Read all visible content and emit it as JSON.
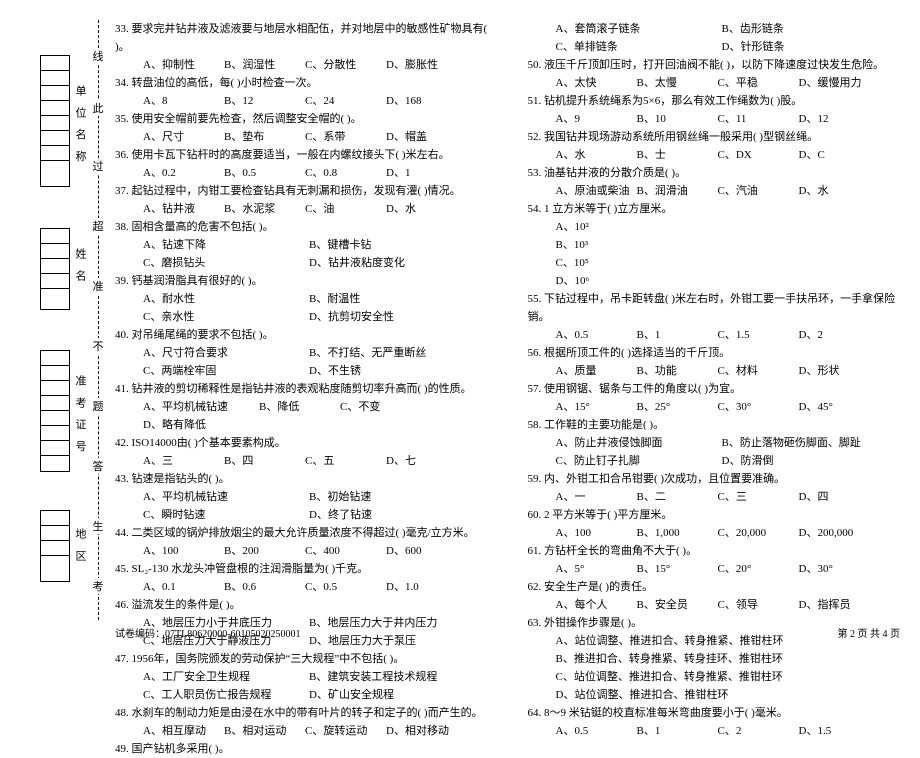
{
  "margin": {
    "labels": {
      "unit": "单 位 名 称",
      "name": "姓    名",
      "exam": "准 考 证 号",
      "area": "地  区"
    },
    "markers": [
      "线",
      "此",
      "过",
      "超",
      "准",
      "不",
      "题",
      "答",
      "生",
      "考"
    ]
  },
  "left": {
    "q33": {
      "stem": "33. 要求完井钻井液及滤液要与地层水相配伍，并对地层中的敏感性矿物具有(    )。",
      "a": "A、抑制性",
      "b": "B、润湿性",
      "c": "C、分散性",
      "d": "D、膨胀性"
    },
    "q34": {
      "stem": "34. 转盘油位的高低，每(    )小时检查一次。",
      "a": "A、8",
      "b": "B、12",
      "c": "C、24",
      "d": "D、168"
    },
    "q35": {
      "stem": "35. 使用安全帽前要先检查，然后调整安全帽的(    )。",
      "a": "A、尺寸",
      "b": "B、垫布",
      "c": "C、系带",
      "d": "D、帽盖"
    },
    "q36": {
      "stem": "36. 使用卡瓦下钻杆时的高度要适当，一般在内螺纹接头下(    )米左右。",
      "a": "A、0.2",
      "b": "B、0.5",
      "c": "C、0.8",
      "d": "D、1"
    },
    "q37": {
      "stem": "37. 起钻过程中，内钳工要检查钻具有无刺漏和损伤，发现有灌(    )情况。",
      "a": "A、钻井液",
      "b": "B、水泥浆",
      "c": "C、油",
      "d": "D、水"
    },
    "q38": {
      "stem": "38. 固相含量高的危害不包括(    )。",
      "a": "A、钻速下降",
      "b": "B、键槽卡钻",
      "c": "C、磨损钻头",
      "d": "D、钻井液粘度变化"
    },
    "q39": {
      "stem": "39. 钙基润滑脂具有很好的(    )。",
      "a": "A、耐水性",
      "b": "B、耐温性",
      "c": "C、亲水性",
      "d": "D、抗剪切安全性"
    },
    "q40": {
      "stem": "40. 对吊绳尾绳的要求不包括(    )。",
      "a": "A、尺寸符合要求",
      "b": "B、不打结、无严重断丝",
      "c": "C、两端栓牢固",
      "d": "D、不生锈"
    },
    "q41": {
      "stem": "41. 钻井液的剪切稀释性是指钻井液的表观粘度随剪切率升高而(    )的性质。",
      "a": "A、平均机械钻速",
      "b": "B、降低",
      "c": "C、不变",
      "d": "D、略有降低"
    },
    "q42": {
      "stem": "42. ISO14000由(    )个基本要素构成。",
      "a": "A、三",
      "b": "B、四",
      "c": "C、五",
      "d": "D、七"
    },
    "q43": {
      "stem": "43. 钻速是指钻头的(    )。",
      "a": "A、平均机械钻速",
      "b": "B、初始钻速",
      "c": "C、瞬时钻速",
      "d": "D、终了钻速"
    },
    "q44": {
      "stem": "44. 二类区域的锅炉排放烟尘的最大允许质量浓度不得超过(    )毫克/立方米。",
      "a": "A、100",
      "b": "B、200",
      "c": "C、400",
      "d": "D、600"
    },
    "q45": {
      "stem": "45. SL₂-130 水龙头冲管盘根的注润滑脂量为(    )千克。",
      "a": "A、0.1",
      "b": "B、0.6",
      "c": "C、0.5",
      "d": "D、1.0"
    },
    "q46": {
      "stem": "46. 溢流发生的条件是(    )。",
      "a": "A、地层压力小于井底压力",
      "b": "B、地层压力大于井内压力",
      "c": "C、地层压力大于静液压力",
      "d": "D、地层压力大于泵压"
    },
    "q47": {
      "stem": "47. 1956年，国务院颁发的劳动保护“三大规程”中不包括(    )。",
      "a": "A、工厂安全卫生规程",
      "b": "B、建筑安装工程技术规程",
      "c": "C、工人职员伤亡报告规程",
      "d": "D、矿山安全规程"
    },
    "q48": {
      "stem": "48. 水刹车的制动力矩是由浸在水中的带有叶片的转子和定子的(    )而产生的。",
      "a": "A、相互摩动",
      "b": "B、相对运动",
      "c": "C、旋转运动",
      "d": "D、相对移动"
    },
    "q49": {
      "stem": "49. 国产钻机多采用(    )。"
    }
  },
  "right": {
    "q49o": {
      "a": "A、套筒滚子链条",
      "b": "B、齿形链条",
      "c": "C、单排链条",
      "d": "D、针形链条"
    },
    "q50": {
      "stem": "50. 液压千斤顶卸压时，打开回油阀不能(    )，以防下降速度过快发生危险。",
      "a": "A、太快",
      "b": "B、太慢",
      "c": "C、平稳",
      "d": "D、缓慢用力"
    },
    "q51": {
      "stem": "51. 钻机提升系统绳系为5×6，那么有效工作绳数为(    )股。",
      "a": "A、9",
      "b": "B、10",
      "c": "C、11",
      "d": "D、12"
    },
    "q52": {
      "stem": "52. 我国钻井现场游动系统所用钢丝绳一般采用(    )型钢丝绳。",
      "a": "A、水",
      "b": "B、士",
      "c": "C、DX",
      "d": "D、C"
    },
    "q53": {
      "stem": "53. 油基钻井液的分散介质是(    )。",
      "a": "A、原油或柴油",
      "b": "B、润滑油",
      "c": "C、汽油",
      "d": "D、水"
    },
    "q54": {
      "stem": "54. 1 立方米等于(    )立方厘米。",
      "a": "A、10²",
      "b": "B、10³",
      "c": "C、10⁵",
      "d": "D、10⁶"
    },
    "q55": {
      "stem": "55. 下钻过程中，吊卡距转盘(    )米左右时，外钳工要一手扶吊环，一手拿保险销。",
      "a": "A、0.5",
      "b": "B、1",
      "c": "C、1.5",
      "d": "D、2"
    },
    "q56": {
      "stem": "56. 根据所顶工件的(    )选择适当的千斤顶。",
      "a": "A、质量",
      "b": "B、功能",
      "c": "C、材料",
      "d": "D、形状"
    },
    "q57": {
      "stem": "57. 使用钢锯、锯条与工件的角度以(    )为宜。",
      "a": "A、15°",
      "b": "B、25°",
      "c": "C、30°",
      "d": "D、45°"
    },
    "q58": {
      "stem": "58. 工作鞋的主要功能是(    )。",
      "a": "A、防止井液侵蚀脚面",
      "b": "B、防止落物砸伤脚面、脚趾",
      "c": "C、防止钉子扎脚",
      "d": "D、防滑倒"
    },
    "q59": {
      "stem": "59. 内、外钳工扣合吊钳要(    )次成功，且位置要准确。",
      "a": "A、一",
      "b": "B、二",
      "c": "C、三",
      "d": "D、四"
    },
    "q60": {
      "stem": "60. 2 平方米等于(    )平方厘米。",
      "a": "A、100",
      "b": "B、1,000",
      "c": "C、20,000",
      "d": "D、200,000"
    },
    "q61": {
      "stem": "61. 方钻杆全长的弯曲角不大于(    )。",
      "a": "A、5°",
      "b": "B、15°",
      "c": "C、20°",
      "d": "D、30°"
    },
    "q62": {
      "stem": "62. 安全生产是(    )的责任。",
      "a": "A、每个人",
      "b": "B、安全员",
      "c": "C、领导",
      "d": "D、指挥员"
    },
    "q63": {
      "stem": "63. 外钳操作步骤是(    )。",
      "a": "A、站位调整、推进扣合、转身推紧、推钳柱环",
      "b": "B、推进扣合、转身推紧、转身挂环、推钳柱环",
      "c": "C、站位调整、推进扣合、转身推紧、推钳柱环",
      "d": "D、站位调整、推进扣合、推钳柱环"
    },
    "q64": {
      "stem": "64. 8～9 米钻铤的校直标准每米弯曲度要小于(    )毫米。",
      "a": "A、0.5",
      "b": "B、1",
      "c": "C、2",
      "d": "D、1.5"
    }
  },
  "footer": {
    "code": "试卷编码：07TL80620000-60105020250001",
    "page": "第 2 页   共 4 页"
  }
}
